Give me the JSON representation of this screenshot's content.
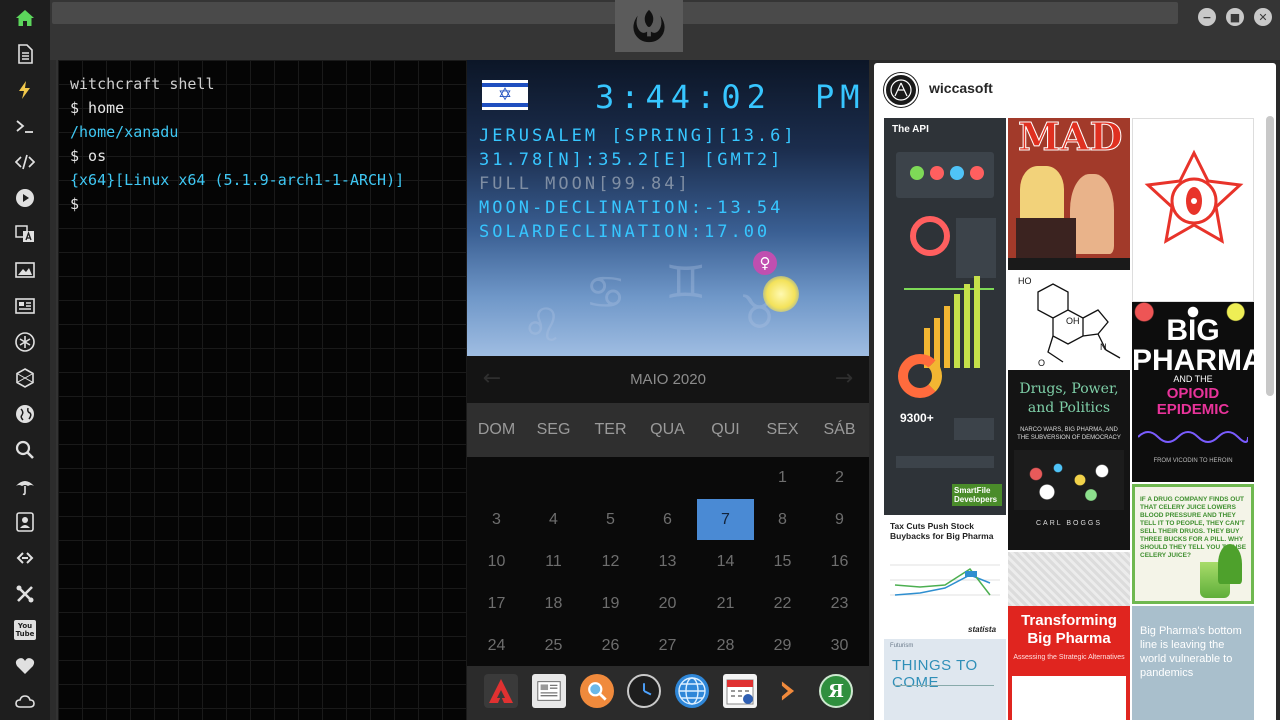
{
  "window": {
    "controls": [
      "minimize",
      "maximize",
      "close"
    ]
  },
  "sidebar": {
    "items": [
      "home-icon",
      "document-icon",
      "bolt-icon",
      "terminal-icon",
      "code-icon",
      "play-icon",
      "translate-icon",
      "image-icon",
      "news-icon",
      "asterisk-icon",
      "hexagon-icon",
      "globe-icon",
      "search-icon",
      "umbrella-icon",
      "contact-icon",
      "link-icon",
      "tools-icon",
      "youtube-icon",
      "heart-icon",
      "cloud-icon"
    ],
    "youtube_text": "You Tube"
  },
  "terminal": {
    "title": "witchcraft shell",
    "lines": [
      {
        "text": "$ home",
        "color": "white"
      },
      {
        "text": "/home/xanadu",
        "color": "cyan"
      },
      {
        "text": "$ os",
        "color": "white"
      },
      {
        "text": "{x64}[Linux x64 (5.1.9-arch1-1-ARCH)]",
        "color": "cyan"
      },
      {
        "text": "$",
        "color": "white"
      }
    ]
  },
  "astro": {
    "flag": "israel",
    "time": "3:44:02",
    "ampm": "PM",
    "location": "JERUSALEM [SPRING][13.6]",
    "coords": "31.78[N]:35.2[E] [GMT2]",
    "moon": "FULL MOON[99.84]",
    "moon_declination": "MOON-DECLINATION:-13.54",
    "solar_declination": "SOLARDECLINATION:17.00",
    "venus_symbol": "♀"
  },
  "calendar": {
    "month_title": "MAIO 2020",
    "prev": "←",
    "next": "→",
    "weekdays": [
      "DOM",
      "SEG",
      "TER",
      "QUA",
      "QUI",
      "SEX",
      "SÁB"
    ],
    "selected": "7",
    "weeks": [
      [
        "",
        "",
        "",
        "",
        "",
        "1",
        "2"
      ],
      [
        "3",
        "4",
        "5",
        "6",
        "7",
        "8",
        "9"
      ],
      [
        "10",
        "11",
        "12",
        "13",
        "14",
        "15",
        "16"
      ],
      [
        "17",
        "18",
        "19",
        "20",
        "21",
        "22",
        "23"
      ],
      [
        "24",
        "25",
        "26",
        "27",
        "28",
        "29",
        "30"
      ]
    ]
  },
  "dock": {
    "items": [
      "arch-app-icon",
      "newspaper-app-icon",
      "search-app-icon",
      "clock-app-icon",
      "globe-app-icon",
      "calendar-app-icon",
      "forward-app-icon",
      "yandex-app-icon"
    ],
    "yandex_letter": "Я"
  },
  "gallery": {
    "account": "wiccasoft",
    "tiles": {
      "api": {
        "title": "The API",
        "footer": "SmartFile Developers",
        "count": "9300+"
      },
      "mad": {
        "title": "MAD"
      },
      "pharma_politics": {
        "title": "Drugs, Power, and Politics",
        "subtitle": "NARCO WARS, BIG PHARMA, AND THE SUBVERSION OF DEMOCRACY",
        "author": "CARL BOGGS"
      },
      "big_pharma": {
        "title": "BIG PHARMA",
        "mid": "AND THE",
        "subtitle": "OPIOID EPIDEMIC",
        "foot": "FROM VICODIN TO HEROIN"
      },
      "celery": {
        "text": "IF A DRUG COMPANY FINDS OUT THAT CELERY JUICE LOWERS BLOOD PRESSURE AND THEY TELL IT TO PEOPLE, THEY CAN'T SELL THEIR DRUGS. THEY BUY THREE BUCKS FOR A PILL. WHY SHOULD THEY TELL YOU TO USE CELERY JUICE?"
      },
      "tax_cuts": {
        "title": "Tax Cuts Push Stock Buybacks for Big Pharma",
        "source": "statista"
      },
      "transforming": {
        "title": "Transforming Big Pharma",
        "subtitle": "Assessing the Strategic Alternatives"
      },
      "things": {
        "title": "THINGS TO COME",
        "kicker": "Futurism"
      },
      "bottom_line": {
        "text": "Big Pharma's bottom line is leaving the world vulnerable to pandemics"
      }
    }
  },
  "colors": {
    "terminal_cyan": "#3fc8f4",
    "clock_cyan": "#37c6ff",
    "calendar_selected": "#4a8ad4",
    "sidebar_home_green": "#5cd65c"
  }
}
